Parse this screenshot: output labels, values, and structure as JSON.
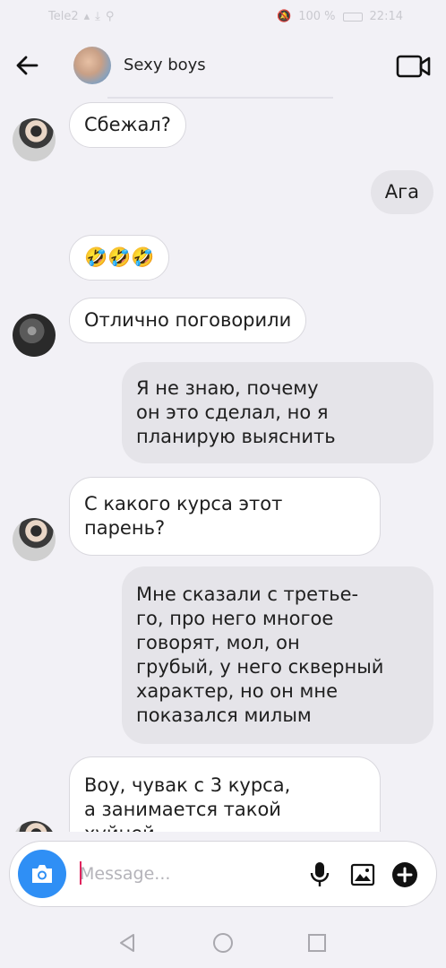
{
  "status": {
    "carrier": "Tele2",
    "battery": "100 %",
    "time": "22:14"
  },
  "header": {
    "title": "Sexy boys",
    "back_icon": "arrow-left-icon",
    "video_icon": "video-camera-icon"
  },
  "messages": [
    {
      "side": "in",
      "text": "Сбежал?"
    },
    {
      "side": "out",
      "text": "Ага"
    },
    {
      "side": "in",
      "text": "🤣🤣🤣"
    },
    {
      "side": "in",
      "text": "Отлично поговорили"
    },
    {
      "side": "out",
      "lines": [
        "Я не знаю, почему",
        "он это сделал, но я",
        "планирую выяснить"
      ]
    },
    {
      "side": "in",
      "lines": [
        "С какого курса этот",
        "парень?"
      ]
    },
    {
      "side": "out",
      "lines": [
        "Мне сказали с третье-",
        "го, про него многое",
        "говорят, мол, он",
        "грубый, у него скверный",
        "характер, но он мне",
        "показался милым"
      ]
    },
    {
      "side": "in",
      "lines": [
        "Воу, чувак с 3 курса,",
        "а занимается такой",
        "хуйней"
      ]
    }
  ],
  "composer": {
    "placeholder": "Message...",
    "camera_icon": "camera-icon",
    "mic_icon": "microphone-icon",
    "gallery_icon": "image-gallery-icon",
    "plus_icon": "plus-circle-icon"
  },
  "colors": {
    "background": "#f2f1f6",
    "incoming_bubble": "#ffffff",
    "outgoing_bubble": "#e5e4e9",
    "camera_button": "#2f8ff5"
  }
}
